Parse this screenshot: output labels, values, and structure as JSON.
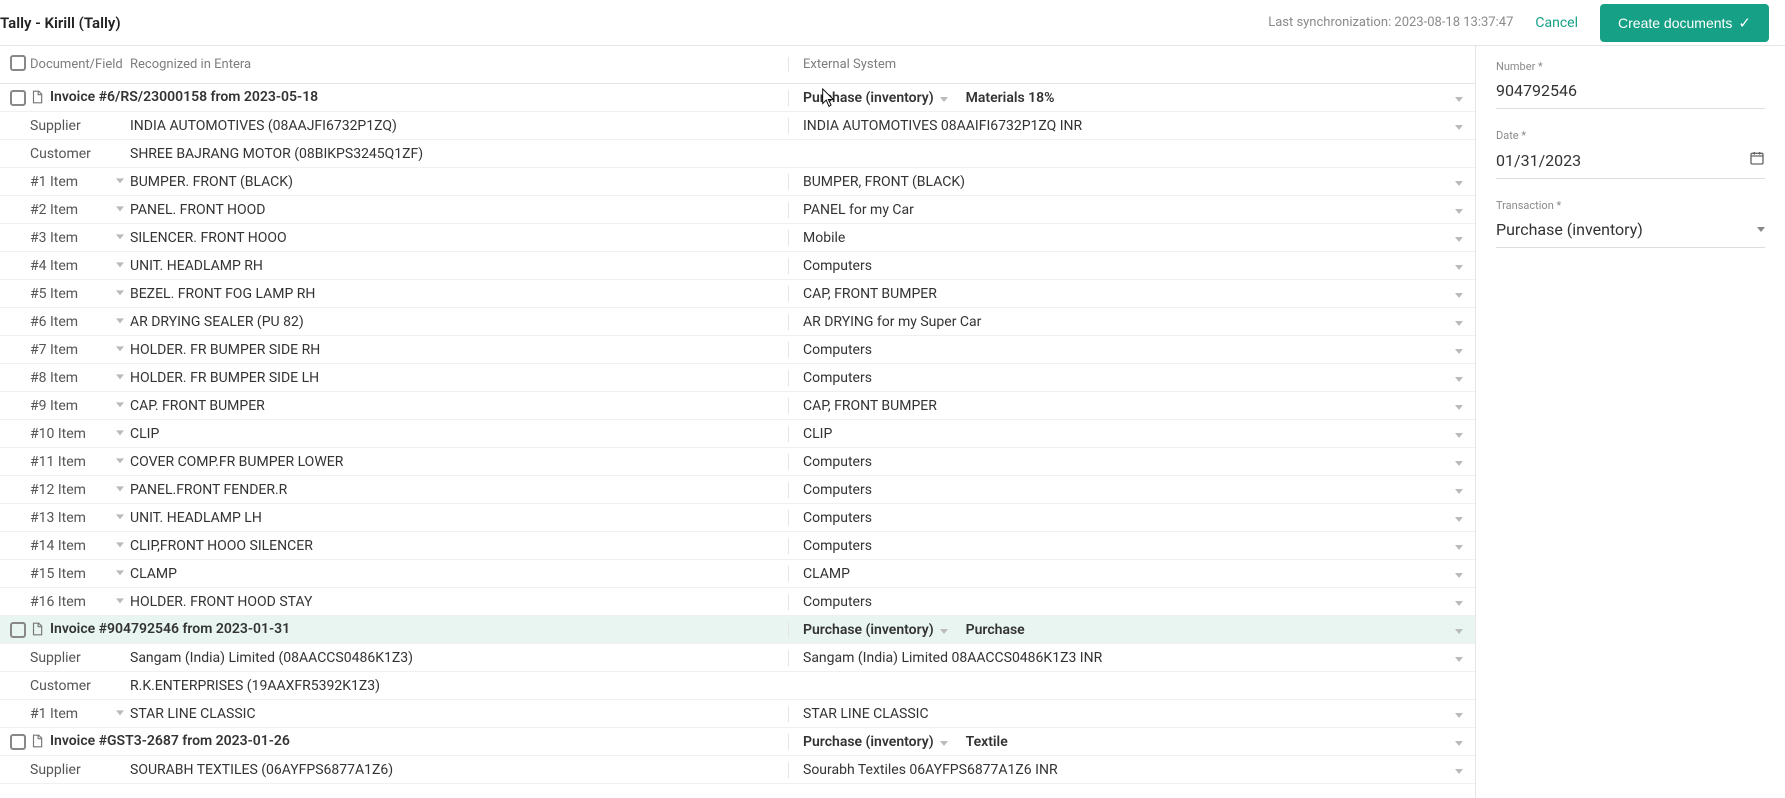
{
  "topbar": {
    "title": "Tally - Kirill (Tally)",
    "sync": "Last synchronization: 2023-08-18 13:37:47",
    "cancel": "Cancel",
    "create": "Create documents"
  },
  "headers": {
    "doc_field": "Document/Field",
    "recognized": "Recognized in Entera",
    "external": "External System"
  },
  "invoices": [
    {
      "id": "inv1",
      "title": "Invoice #6/RS/23000158 from 2023-05-18",
      "ext_type": "Purchase (inventory)",
      "ext_cat": "Materials 18%",
      "highlight": false,
      "supplier_label": "Supplier",
      "supplier_recog": "INDIA AUTOMOTIVES (08AAJFI6732P1ZQ)",
      "supplier_ext": "INDIA AUTOMOTIVES 08AAIFI6732P1ZQ INR",
      "customer_label": "Customer",
      "customer_recog": "SHREE BAJRANG MOTOR (08BIKPS3245Q1ZF)",
      "customer_ext": "",
      "items": [
        {
          "field": "#1 Item",
          "recog": "BUMPER. FRONT (BLACK)",
          "ext": "BUMPER, FRONT (BLACK)"
        },
        {
          "field": "#2 Item",
          "recog": "PANEL. FRONT HOOD",
          "ext": "PANEL for my Car"
        },
        {
          "field": "#3 Item",
          "recog": "SILENCER. FRONT HOOO",
          "ext": "Mobile"
        },
        {
          "field": "#4 Item",
          "recog": "UNIT. HEADLAMP RH",
          "ext": "Computers"
        },
        {
          "field": "#5 Item",
          "recog": "BEZEL. FRONT FOG LAMP RH",
          "ext": "CAP, FRONT BUMPER"
        },
        {
          "field": "#6 Item",
          "recog": "AR DRYING SEALER (PU 82)",
          "ext": "AR DRYING for my Super Car"
        },
        {
          "field": "#7 Item",
          "recog": "HOLDER. FR BUMPER SIDE RH",
          "ext": "Computers"
        },
        {
          "field": "#8 Item",
          "recog": "HOLDER. FR BUMPER SIDE LH",
          "ext": "Computers"
        },
        {
          "field": "#9 Item",
          "recog": "CAP. FRONT BUMPER",
          "ext": "CAP, FRONT BUMPER"
        },
        {
          "field": "#10 Item",
          "recog": "CLIP",
          "ext": "CLIP"
        },
        {
          "field": "#11 Item",
          "recog": "COVER COMP.FR BUMPER LOWER",
          "ext": "Computers"
        },
        {
          "field": "#12 Item",
          "recog": "PANEL.FRONT FENDER.R",
          "ext": "Computers"
        },
        {
          "field": "#13 Item",
          "recog": "UNIT. HEADLAMP LH",
          "ext": "Computers"
        },
        {
          "field": "#14 Item",
          "recog": "CLIP,FRONT HOOO SILENCER",
          "ext": "Computers"
        },
        {
          "field": "#15 Item",
          "recog": "CLAMP",
          "ext": "CLAMP"
        },
        {
          "field": "#16 Item",
          "recog": "HOLDER. FRONT HOOD STAY",
          "ext": "Computers"
        }
      ]
    },
    {
      "id": "inv2",
      "title": "Invoice #904792546 from 2023-01-31",
      "ext_type": "Purchase (inventory)",
      "ext_cat": "Purchase",
      "highlight": true,
      "supplier_label": "Supplier",
      "supplier_recog": "Sangam (India) Limited (08AACCS0486K1Z3)",
      "supplier_ext": "Sangam (India) Limited 08AACCS0486K1Z3 INR",
      "customer_label": "Customer",
      "customer_recog": "R.K.ENTERPRISES (19AAXFR5392K1Z3)",
      "customer_ext": "",
      "items": [
        {
          "field": "#1 Item",
          "recog": "STAR LINE CLASSIC",
          "ext": "STAR LINE CLASSIC"
        }
      ]
    },
    {
      "id": "inv3",
      "title": "Invoice #GST3-2687 from 2023-01-26",
      "ext_type": "Purchase (inventory)",
      "ext_cat": "Textile",
      "highlight": false,
      "supplier_label": "Supplier",
      "supplier_recog": "SOURABH TEXTILES (06AYFPS6877A1Z6)",
      "supplier_ext": "Sourabh Textiles 06AYFPS6877A1Z6 INR",
      "customer_label": "",
      "customer_recog": "",
      "customer_ext": "",
      "items": []
    }
  ],
  "side": {
    "number_label": "Number *",
    "number_value": "904792546",
    "date_label": "Date *",
    "date_value": "01/31/2023",
    "txn_label": "Transaction *",
    "txn_value": "Purchase (inventory)"
  }
}
